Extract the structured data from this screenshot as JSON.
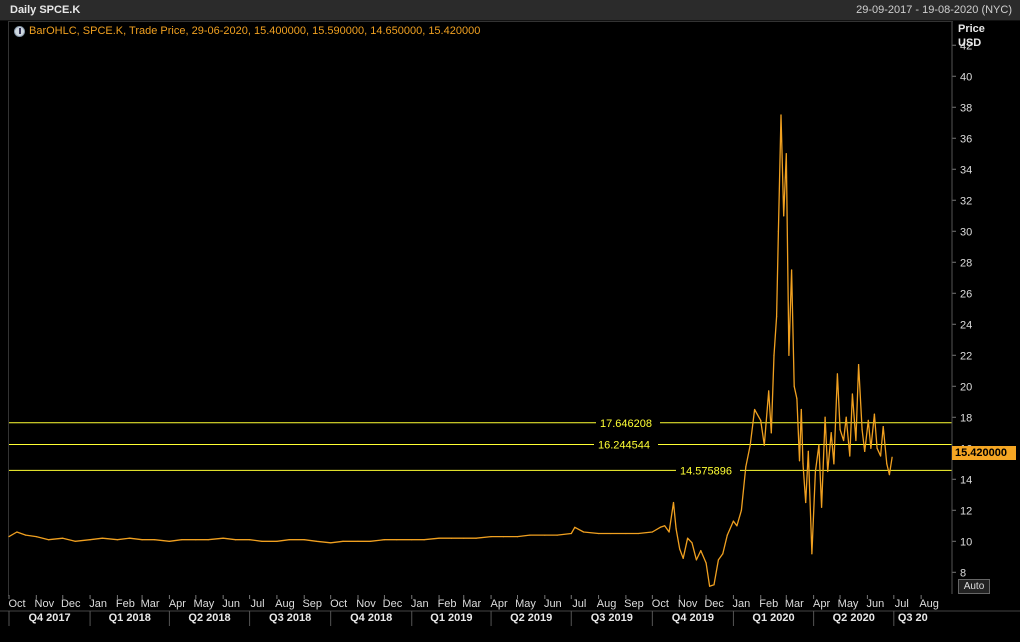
{
  "header": {
    "title": "Daily SPCE.K",
    "date_range": "29-09-2017 - 19-08-2020 (NYC)"
  },
  "legend": {
    "text": "BarOHLC, SPCE.K, Trade Price, 29-06-2020, 15.400000, 15.590000, 14.650000, 15.420000"
  },
  "axis": {
    "y_title": "Price",
    "y_unit": "USD",
    "auto_label": "Auto",
    "last_price": "15.420000"
  },
  "colors": {
    "series": "#f0a020",
    "hline": "#ffff33",
    "background": "#000000"
  },
  "chart_data": {
    "type": "line",
    "ylim": [
      6.6,
      43.5
    ],
    "y_ticks": [
      8,
      10,
      12,
      14,
      16,
      18,
      20,
      22,
      24,
      26,
      28,
      30,
      32,
      34,
      36,
      38,
      40,
      42
    ],
    "month_labels": [
      "Oct",
      "Nov",
      "Dec",
      "Jan",
      "Feb",
      "Mar",
      "Apr",
      "May",
      "Jun",
      "Jul",
      "Aug",
      "Sep",
      "Oct",
      "Nov",
      "Dec",
      "Jan",
      "Feb",
      "Mar",
      "Apr",
      "May",
      "Jun",
      "Jul",
      "Aug",
      "Sep",
      "Oct",
      "Nov",
      "Dec",
      "Jan",
      "Feb",
      "Mar",
      "Apr",
      "May",
      "Jun",
      "Jul",
      "Aug"
    ],
    "quarter_labels": [
      "Q4 2017",
      "Q1 2018",
      "Q2 2018",
      "Q3 2018",
      "Q4 2018",
      "Q1 2019",
      "Q2 2019",
      "Q3 2019",
      "Q4 2019",
      "Q1 2020",
      "Q2 2020",
      "Q3 20"
    ],
    "horizontal_lines": [
      {
        "label": "17.646208",
        "value": 17.646208
      },
      {
        "label": "16.244544",
        "value": 16.244544
      },
      {
        "label": "14.575896",
        "value": 14.575896
      }
    ],
    "series": [
      {
        "x": [
          "2017-10-01",
          "2017-10-10",
          "2017-10-20",
          "2017-11-01",
          "2017-11-15",
          "2017-12-01",
          "2017-12-15",
          "2018-01-01",
          "2018-01-15",
          "2018-02-01",
          "2018-02-15",
          "2018-03-01",
          "2018-03-15",
          "2018-04-01",
          "2018-04-15",
          "2018-05-01",
          "2018-05-15",
          "2018-06-01",
          "2018-06-15",
          "2018-07-01",
          "2018-07-15",
          "2018-08-01",
          "2018-08-15",
          "2018-09-01",
          "2018-09-15",
          "2018-10-01",
          "2018-10-15",
          "2018-11-01",
          "2018-11-15",
          "2018-12-01",
          "2018-12-15",
          "2019-01-01",
          "2019-01-15",
          "2019-02-01",
          "2019-02-15",
          "2019-03-01",
          "2019-03-15",
          "2019-04-01",
          "2019-04-15",
          "2019-05-01",
          "2019-05-15",
          "2019-06-01",
          "2019-06-15",
          "2019-07-01",
          "2019-07-05",
          "2019-07-15",
          "2019-08-01",
          "2019-08-15",
          "2019-09-01",
          "2019-09-15",
          "2019-10-01",
          "2019-10-10",
          "2019-10-15",
          "2019-10-20",
          "2019-10-25",
          "2019-10-28",
          "2019-11-01",
          "2019-11-05",
          "2019-11-10",
          "2019-11-15",
          "2019-11-20",
          "2019-11-25",
          "2019-12-01",
          "2019-12-05",
          "2019-12-10",
          "2019-12-15",
          "2019-12-20",
          "2019-12-25",
          "2020-01-01",
          "2020-01-05",
          "2020-01-10",
          "2020-01-15",
          "2020-01-20",
          "2020-01-25",
          "2020-02-01",
          "2020-02-05",
          "2020-02-10",
          "2020-02-13",
          "2020-02-16",
          "2020-02-19",
          "2020-02-21",
          "2020-02-24",
          "2020-02-27",
          "2020-03-01",
          "2020-03-04",
          "2020-03-07",
          "2020-03-10",
          "2020-03-13",
          "2020-03-16",
          "2020-03-18",
          "2020-03-20",
          "2020-03-23",
          "2020-03-26",
          "2020-03-30",
          "2020-04-03",
          "2020-04-07",
          "2020-04-10",
          "2020-04-14",
          "2020-04-17",
          "2020-04-21",
          "2020-04-24",
          "2020-04-28",
          "2020-05-01",
          "2020-05-05",
          "2020-05-08",
          "2020-05-12",
          "2020-05-15",
          "2020-05-19",
          "2020-05-22",
          "2020-05-26",
          "2020-05-29",
          "2020-06-02",
          "2020-06-05",
          "2020-06-09",
          "2020-06-12",
          "2020-06-16",
          "2020-06-19",
          "2020-06-23",
          "2020-06-26",
          "2020-06-29"
        ],
        "values": [
          10.3,
          10.6,
          10.4,
          10.3,
          10.1,
          10.2,
          10.0,
          10.1,
          10.2,
          10.1,
          10.2,
          10.1,
          10.1,
          10.0,
          10.1,
          10.1,
          10.1,
          10.2,
          10.1,
          10.1,
          10.0,
          10.0,
          10.1,
          10.1,
          10.0,
          9.9,
          10.0,
          10.0,
          10.0,
          10.1,
          10.1,
          10.1,
          10.1,
          10.2,
          10.2,
          10.2,
          10.2,
          10.3,
          10.3,
          10.3,
          10.4,
          10.4,
          10.4,
          10.5,
          10.9,
          10.6,
          10.5,
          10.5,
          10.5,
          10.5,
          10.6,
          10.9,
          11.0,
          10.6,
          12.5,
          10.8,
          9.5,
          8.9,
          10.2,
          9.9,
          8.8,
          9.4,
          8.6,
          7.1,
          7.2,
          8.8,
          9.2,
          10.4,
          11.3,
          11.0,
          12.0,
          14.8,
          16.2,
          18.5,
          17.8,
          16.2,
          19.7,
          17.0,
          22.0,
          24.5,
          30.0,
          37.5,
          31.0,
          35.0,
          22.0,
          27.5,
          20.0,
          19.2,
          15.2,
          18.5,
          15.0,
          12.5,
          15.8,
          9.2,
          14.5,
          16.2,
          12.2,
          18.0,
          14.5,
          17.0,
          15.0,
          20.8,
          17.2,
          16.5,
          18.0,
          15.5,
          19.5,
          16.5,
          21.4,
          17.2,
          15.8,
          17.8,
          16.0,
          18.2,
          16.0,
          15.5,
          17.4,
          15.0,
          14.3,
          15.42
        ]
      }
    ]
  }
}
